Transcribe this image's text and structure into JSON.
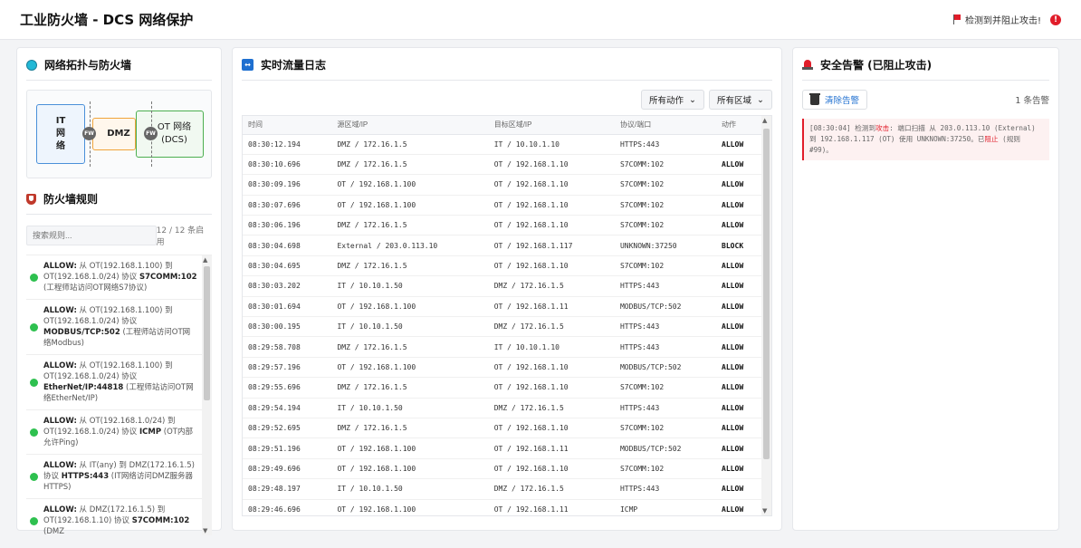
{
  "header": {
    "title": "工业防火墙 - DCS 网络保护",
    "status_text": "检测到并阻止攻击!",
    "badge": "!",
    "colors": {
      "alert": "#e11d2a"
    }
  },
  "topology": {
    "title": "网络拓扑与防火墙",
    "it_label": "IT\n网\n络",
    "dmz_label": "DMZ",
    "ot_label": "OT 网络\n(DCS)",
    "fw_label": "FW"
  },
  "rules": {
    "title": "防火墙规则",
    "search_placeholder": "搜索规则...",
    "count": "12 / 12 条启用",
    "items": [
      {
        "action": "ALLOW:",
        "text": " 从 OT(192.168.1.100) 到 OT(192.168.1.0/24) 协议 ",
        "proto": "S7COMM:102",
        "desc": " (工程师站访问OT网络S7协议)"
      },
      {
        "action": "ALLOW:",
        "text": " 从 OT(192.168.1.100) 到 OT(192.168.1.0/24) 协议 ",
        "proto": "MODBUS/TCP:502",
        "desc": " (工程师站访问OT网络Modbus)"
      },
      {
        "action": "ALLOW:",
        "text": " 从 OT(192.168.1.100) 到 OT(192.168.1.0/24) 协议 ",
        "proto": "EtherNet/IP:44818",
        "desc": " (工程师站访问OT网络EtherNet/IP)"
      },
      {
        "action": "ALLOW:",
        "text": " 从 OT(192.168.1.0/24) 到 OT(192.168.1.0/24) 协议 ",
        "proto": "ICMP",
        "desc": " (OT内部允许Ping)"
      },
      {
        "action": "ALLOW:",
        "text": " 从 IT(any) 到 DMZ(172.16.1.5) 协议 ",
        "proto": "HTTPS:443",
        "desc": " (IT网络访问DMZ服务器HTTPS)"
      },
      {
        "action": "ALLOW:",
        "text": " 从 DMZ(172.16.1.5) 到 OT(192.168.1.10) 协议 ",
        "proto": "S7COMM:102",
        "desc": " (DMZ"
      }
    ]
  },
  "log": {
    "title": "实时流量日志",
    "filter_action": "所有动作",
    "filter_zone": "所有区域",
    "columns": [
      "时间",
      "源区域/IP",
      "目标区域/IP",
      "协议/端口",
      "动作"
    ],
    "rows": [
      [
        "08:30:12.194",
        "DMZ / 172.16.1.5",
        "IT / 10.10.1.10",
        "HTTPS:443",
        "ALLOW"
      ],
      [
        "08:30:10.696",
        "DMZ / 172.16.1.5",
        "OT / 192.168.1.10",
        "S7COMM:102",
        "ALLOW"
      ],
      [
        "08:30:09.196",
        "OT / 192.168.1.100",
        "OT / 192.168.1.10",
        "S7COMM:102",
        "ALLOW"
      ],
      [
        "08:30:07.696",
        "OT / 192.168.1.100",
        "OT / 192.168.1.10",
        "S7COMM:102",
        "ALLOW"
      ],
      [
        "08:30:06.196",
        "DMZ / 172.16.1.5",
        "OT / 192.168.1.10",
        "S7COMM:102",
        "ALLOW"
      ],
      [
        "08:30:04.698",
        "External / 203.0.113.10",
        "OT / 192.168.1.117",
        "UNKNOWN:37250",
        "BLOCK"
      ],
      [
        "08:30:04.695",
        "DMZ / 172.16.1.5",
        "OT / 192.168.1.10",
        "S7COMM:102",
        "ALLOW"
      ],
      [
        "08:30:03.202",
        "IT / 10.10.1.50",
        "DMZ / 172.16.1.5",
        "HTTPS:443",
        "ALLOW"
      ],
      [
        "08:30:01.694",
        "OT / 192.168.1.100",
        "OT / 192.168.1.11",
        "MODBUS/TCP:502",
        "ALLOW"
      ],
      [
        "08:30:00.195",
        "IT / 10.10.1.50",
        "DMZ / 172.16.1.5",
        "HTTPS:443",
        "ALLOW"
      ],
      [
        "08:29:58.708",
        "DMZ / 172.16.1.5",
        "IT / 10.10.1.10",
        "HTTPS:443",
        "ALLOW"
      ],
      [
        "08:29:57.196",
        "OT / 192.168.1.100",
        "OT / 192.168.1.10",
        "MODBUS/TCP:502",
        "ALLOW"
      ],
      [
        "08:29:55.696",
        "DMZ / 172.16.1.5",
        "OT / 192.168.1.10",
        "S7COMM:102",
        "ALLOW"
      ],
      [
        "08:29:54.194",
        "IT / 10.10.1.50",
        "DMZ / 172.16.1.5",
        "HTTPS:443",
        "ALLOW"
      ],
      [
        "08:29:52.695",
        "DMZ / 172.16.1.5",
        "OT / 192.168.1.10",
        "S7COMM:102",
        "ALLOW"
      ],
      [
        "08:29:51.196",
        "OT / 192.168.1.100",
        "OT / 192.168.1.11",
        "MODBUS/TCP:502",
        "ALLOW"
      ],
      [
        "08:29:49.696",
        "OT / 192.168.1.100",
        "OT / 192.168.1.10",
        "S7COMM:102",
        "ALLOW"
      ],
      [
        "08:29:48.197",
        "IT / 10.10.1.50",
        "DMZ / 172.16.1.5",
        "HTTPS:443",
        "ALLOW"
      ],
      [
        "08:29:46.696",
        "OT / 192.168.1.100",
        "OT / 192.168.1.11",
        "ICMP",
        "ALLOW"
      ]
    ]
  },
  "alerts": {
    "title": "安全告警 (已阻止攻击)",
    "clear_label": "清除告警",
    "count": "1 条告警",
    "items": [
      {
        "p1": "[08:30:04] 检测到",
        "p2": "攻击",
        "p3": ": 端口扫描 从 203.0.113.10 (External) 到 192.168.1.117 (OT) 使用 UNKNOWN:37250。已",
        "p4": "阻止",
        "p5": " (规则 #99)。"
      }
    ]
  }
}
